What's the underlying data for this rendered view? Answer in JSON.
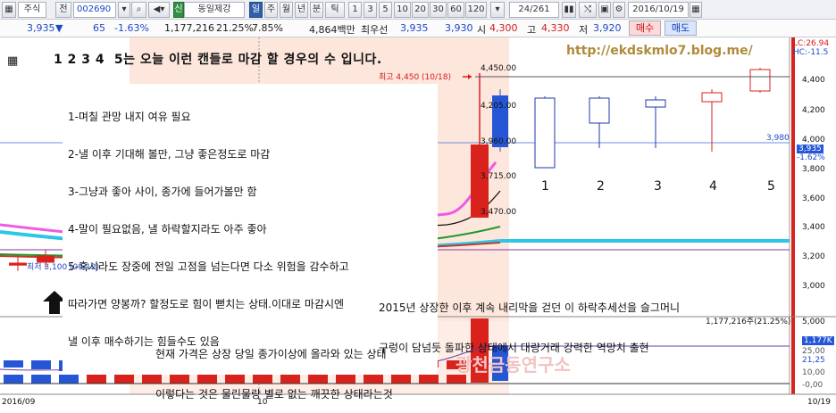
{
  "toolbar": {
    "market_label": "주식",
    "market_glyph": "전",
    "stock_code": "002690",
    "stock_name_badge": "신",
    "stock_name": "동일제강",
    "periods": [
      "일",
      "주",
      "월",
      "년",
      "분",
      "틱"
    ],
    "intervals": [
      "1",
      "3",
      "5",
      "10",
      "20",
      "30",
      "60",
      "120"
    ],
    "page_counter": "24/261",
    "date": "2016/10/19"
  },
  "quote": {
    "price": "3,935",
    "direction_glyph": "▼",
    "change": "65",
    "change_pct": "-1.63%",
    "volume": "1,177,216",
    "volume_ratio": "21.25%",
    "turnover": "7.85%",
    "amount": "4,864백만",
    "bid_label": "최우선",
    "ask_price": "3,935",
    "bid_price": "3,930",
    "open_label": "시",
    "open": "4,300",
    "high_label": "고",
    "high": "4,330",
    "low_label": "저",
    "low": "3,920",
    "buy_label": "매수",
    "sell_label": "매도"
  },
  "chart": {
    "header_text": "1 2 3 4  5는 오늘 이런 캔들로 마감 할 경우의 수 입니다.",
    "watermark_url": "http://ekdskmlo7.blog.me/",
    "max_label": "최고 4,450 (10/18)",
    "min_label": "최저 3,100 (09/12)",
    "price_marks": [
      "4,450.00",
      "4,205.00",
      "3,960.00",
      "3,715.00",
      "3,470.00"
    ],
    "lc_label": "LC:26.94",
    "hc_label": "HC:-11.5",
    "current_price": "3,935",
    "current_pct": "-1.62%",
    "ref_price": "3,980",
    "y_axis": [
      "4,400",
      "4,200",
      "4,000",
      "3,800",
      "3,600",
      "3,400",
      "3,200",
      "3,000"
    ],
    "case_numbers": [
      "1",
      "2",
      "3",
      "4",
      "5"
    ],
    "notes": [
      "1-며칠 관망 내지 여유 필요",
      "2-낼 이후 기대해 볼만, 그냥 좋은정도로 마감",
      "3-그냥과 좋아 사이, 종가에 들어가볼만 함",
      "4-말이 필요없음, 낼 하락할지라도 아주 좋아",
      "5-혹시라도 장중에 전일 고점을 넘는다면 다소 위험을 감수하고",
      "따라가면 양봉까? 할정도로 힘이 뻗치는 상태.이대로 마감시엔",
      "낼 이후 매수하기는 힘들수도 있음"
    ],
    "comment_lines": [
      "2015년 상장한 이후 계속 내리막을 걷던 이 하락추세선을 슬그머니",
      "구렁이 담넘듯 돌파한 상태에서 대량거래 강력한 역망치 출현"
    ]
  },
  "volume_panel": {
    "lines": [
      "현재 가격은 상장 당일 종가이상에 올라와 있는 상태",
      "이렇다는 것은 물린물량 별로 없는 깨끗한 상태라는것"
    ],
    "volume_label": "1,177,216주(21.25%)",
    "v_axis_top": "5,000",
    "v_current": "1,177K",
    "v_pct_a": "25,00",
    "v_pct_b": "21,25",
    "v_pct_c": "10,00",
    "v_pct_d": "-0,00",
    "watermark": "광천금동연구소"
  },
  "x_axis": {
    "start": "2016/09",
    "mid": "10",
    "end": "10/19"
  },
  "colors": {
    "up": "#d9221c",
    "down": "#2456d6",
    "highlight": "#fde6dc",
    "cyan_line": "#2ec6e6",
    "magenta_line": "#f05ae6",
    "green_arrow": "#1a8a2a"
  },
  "chart_data": {
    "type": "candlestick",
    "series_prices": [
      3150,
      3200,
      3230,
      3280,
      3260,
      3300,
      3340,
      3320,
      3380,
      3400,
      3420,
      3440,
      3500,
      3460,
      3900,
      4205,
      3935
    ]
  }
}
